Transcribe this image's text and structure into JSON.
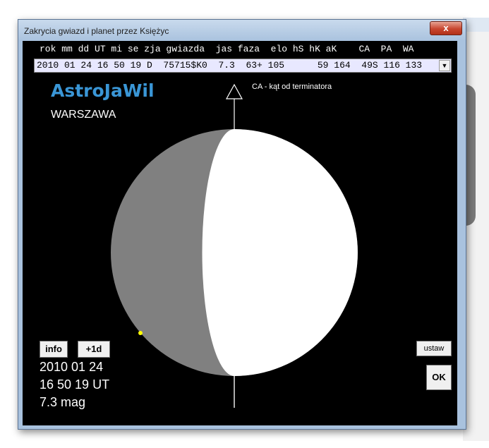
{
  "window": {
    "title": "Zakrycia gwiazd i planet przez Księżyc",
    "close_glyph": "x"
  },
  "table": {
    "header": "rok mm dd UT mi se zja gwiazda  jas faza  elo hS hK aK    CA  PA  WA",
    "selected_row": "2010 01 24 16 50 19 D  75715$K0  7.3  63+ 105      59 164  49S 116 133"
  },
  "app_name": "AstroJaWil",
  "location": "WARSZAWA",
  "diagram": {
    "ca_label": "CA - kąt od terminatora",
    "phase_percent": 63,
    "waxing": true,
    "colors": {
      "background": "#000000",
      "lit": "#ffffff",
      "dark": "#808080",
      "star": "#ffff00",
      "axis": "#ffffff"
    }
  },
  "buttons": {
    "info": "info",
    "plus1d": "+1d",
    "ustaw": "ustaw",
    "ok": "OK"
  },
  "event": {
    "date": "2010 01 24",
    "time": "16 50 19 UT",
    "magnitude": "7.3 mag"
  },
  "icons": {
    "dropdown": "chevron-down-icon",
    "close": "close-icon"
  }
}
